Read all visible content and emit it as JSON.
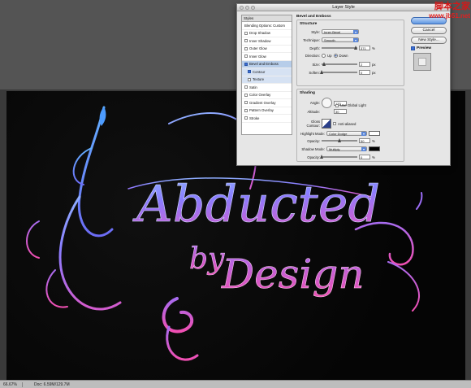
{
  "dialog": {
    "title": "Layer Style",
    "styles_header": "Styles",
    "styles": [
      {
        "label": "Blending Options: Custom",
        "checkbox": false,
        "checked": false
      },
      {
        "label": "Drop Shadow",
        "checkbox": true,
        "checked": false
      },
      {
        "label": "Inner Shadow",
        "checkbox": true,
        "checked": false
      },
      {
        "label": "Outer Glow",
        "checkbox": true,
        "checked": false
      },
      {
        "label": "Inner Glow",
        "checkbox": true,
        "checked": false
      },
      {
        "label": "Bevel and Emboss",
        "checkbox": true,
        "checked": true,
        "selected": true
      },
      {
        "label": "Contour",
        "checkbox": true,
        "checked": true,
        "sub": true
      },
      {
        "label": "Texture",
        "checkbox": true,
        "checked": false,
        "sub": true
      },
      {
        "label": "Satin",
        "checkbox": true,
        "checked": false
      },
      {
        "label": "Color Overlay",
        "checkbox": true,
        "checked": false
      },
      {
        "label": "Gradient Overlay",
        "checkbox": true,
        "checked": false
      },
      {
        "label": "Pattern Overlay",
        "checkbox": true,
        "checked": false
      },
      {
        "label": "Stroke",
        "checkbox": true,
        "checked": false
      }
    ],
    "section_title": "Bevel and Emboss",
    "structure": {
      "title": "Structure",
      "style_label": "Style:",
      "style_value": "Inner Bevel",
      "technique_label": "Technique:",
      "technique_value": "Smooth",
      "depth_label": "Depth:",
      "depth_value": "371",
      "depth_unit": "%",
      "direction_label": "Direction:",
      "direction_up": "Up",
      "direction_down": "Down",
      "size_label": "Size:",
      "size_value": "2",
      "size_unit": "px",
      "soften_label": "Soften:",
      "soften_value": "0",
      "soften_unit": "px"
    },
    "shading": {
      "title": "Shading",
      "angle_label": "Angle:",
      "angle_value": "120",
      "global_light_label": "Use Global Light",
      "altitude_label": "Altitude:",
      "altitude_value": "30",
      "gloss_label": "Gloss Contour:",
      "antialiased_label": "Anti-aliased",
      "highlight_label": "Highlight Mode:",
      "highlight_value": "Color Dodge",
      "highlight_color": "#ffffff",
      "opacity1_label": "Opacity:",
      "opacity1_value": "50",
      "opacity_unit": "%",
      "shadow_label": "Shadow Mode:",
      "shadow_value": "Multiply",
      "shadow_color": "#000000",
      "opacity2_label": "Opacity:",
      "opacity2_value": "0"
    },
    "buttons": {
      "ok": "",
      "cancel": "Cancel",
      "new_style": "New Style...",
      "preview": "Preview"
    }
  },
  "artwork": {
    "line1": "Abducted",
    "line2": "by",
    "line3": "Design"
  },
  "status": {
    "zoom": "66.67%",
    "doc": "Doc: 6.59M/129.7M"
  },
  "watermark": {
    "line1": "脚本之家",
    "line2": "www.jb51.net"
  },
  "colors": {
    "blue": "#5a78ff",
    "purple": "#a25bd9",
    "pink": "#e24fb8",
    "canvas": "#050505"
  }
}
